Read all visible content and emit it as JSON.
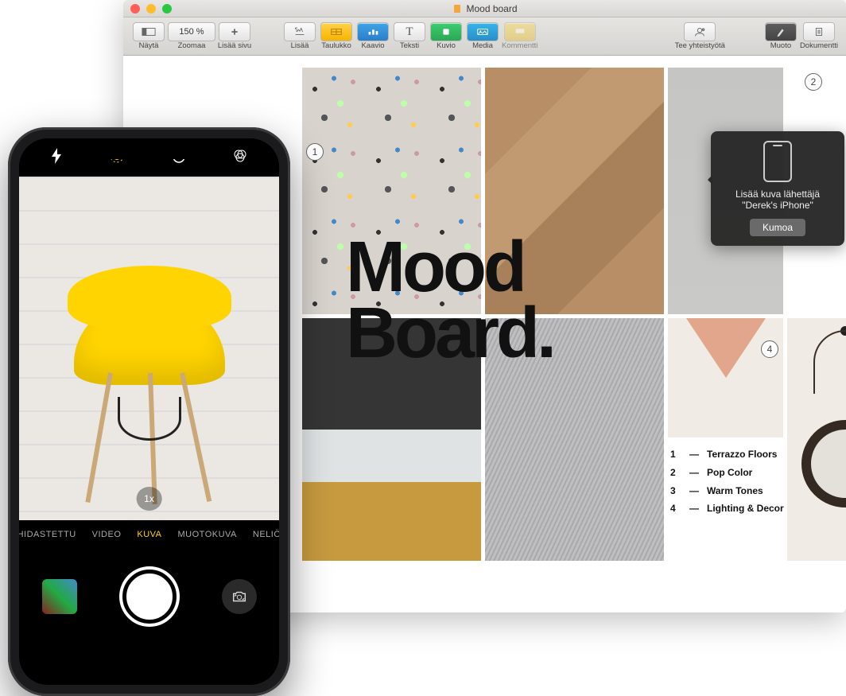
{
  "window": {
    "title": "Mood board",
    "toolbar": {
      "view": "Näytä",
      "zoom_value": "150 %",
      "zoom_label": "Zoomaa",
      "add_page": "Lisää sivu",
      "insert": "Lisää",
      "table": "Taulukko",
      "chart": "Kaavio",
      "text": "Teksti",
      "shape": "Kuvio",
      "media": "Media",
      "comment": "Kommentti",
      "collaborate": "Tee yhteistyötä",
      "format": "Muoto",
      "document": "Dokumentti"
    }
  },
  "moodboard": {
    "heading_l1": "Mood",
    "heading_l2": "Board.",
    "callouts": {
      "c1": "1",
      "c2": "2",
      "c4": "4"
    },
    "legend": [
      {
        "n": "1",
        "label": "Terrazzo Floors"
      },
      {
        "n": "2",
        "label": "Pop Color"
      },
      {
        "n": "3",
        "label": "Warm Tones"
      },
      {
        "n": "4",
        "label": "Lighting & Decor"
      }
    ]
  },
  "popover": {
    "line1": "Lisää kuva lähettäjä",
    "line2": "\"Derek's iPhone\"",
    "button": "Kumoa"
  },
  "iphone": {
    "zoom": "1x",
    "modes": {
      "slomo": "HIDASTETTU",
      "video": "VIDEO",
      "photo": "KUVA",
      "portrait": "MUOTOKUVA",
      "pano": "NELIÖ"
    }
  }
}
